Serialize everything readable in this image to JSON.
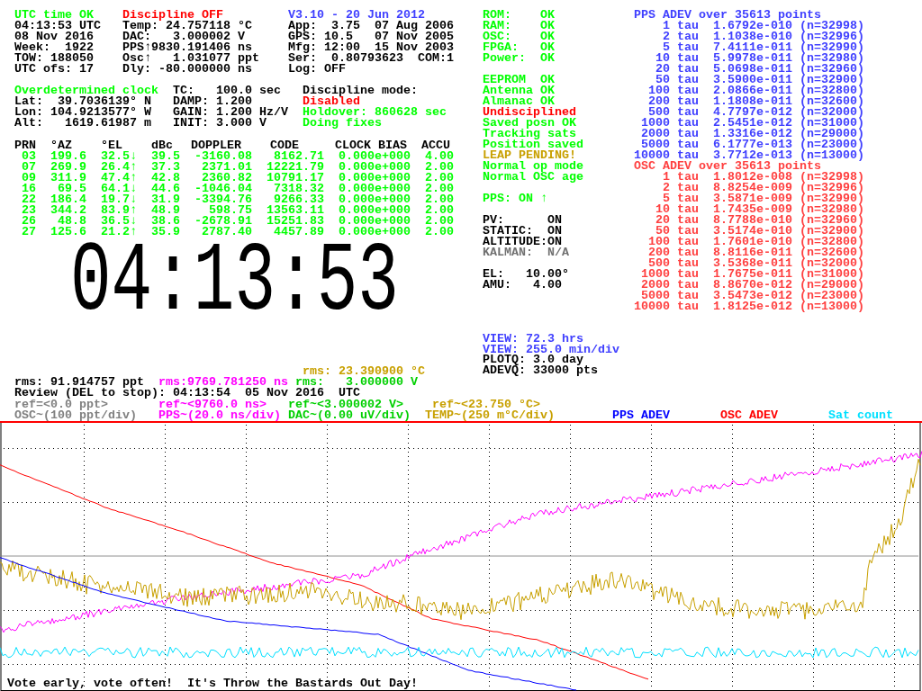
{
  "top_block": [
    {
      "lines": [
        {
          "text": "UTC time OK",
          "color": "#00ff00"
        },
        {
          "text": "04:13:53 UTC",
          "color": "#000000"
        },
        {
          "text": "08 Nov 2016",
          "color": "#000000"
        },
        {
          "text": "Week:  1922",
          "color": "#000000"
        },
        {
          "text": "TOW: 188050",
          "color": "#000000"
        },
        {
          "text": "UTC ofs: 17",
          "color": "#000000"
        }
      ]
    },
    {
      "lines": [
        {
          "text": "Discipline OFF",
          "color": "#ff0000"
        },
        {
          "text": "Temp: 24.757118 °C",
          "color": "#000000"
        },
        {
          "text": "DAC:   3.000002 V",
          "color": "#000000"
        },
        {
          "text": "PPS↑9830.191406 ns",
          "color": "#000000"
        },
        {
          "text": "Osc↑   1.031077 ppt",
          "color": "#000000"
        },
        {
          "text": "Dly: -80.000000 ns",
          "color": "#000000"
        }
      ]
    },
    {
      "lines": [
        {
          "text": "V3.10 - 20 Jun 2012",
          "color": "#4040ff"
        },
        {
          "text": "App:  3.75  07 Aug 2006",
          "color": "#000000"
        },
        {
          "text": "GPS: 10.5   07 Nov 2005",
          "color": "#000000"
        },
        {
          "text": "Mfg: 12:00  15 Nov 2003",
          "color": "#000000"
        },
        {
          "text": "Ser:  0.80793623  COM:1",
          "color": "#000000"
        },
        {
          "text": "Log: OFF",
          "color": "#000000"
        }
      ]
    }
  ],
  "position_block": [
    {
      "lines": [
        {
          "text": "Overdetermined clock",
          "color": "#00ff00"
        },
        {
          "text": "Lat:  39.7036139° N",
          "color": "#000000"
        },
        {
          "text": "Lon: 104.9213577° W",
          "color": "#000000"
        },
        {
          "text": "Alt:   1619.61987 m",
          "color": "#000000"
        }
      ]
    },
    {
      "lines": [
        {
          "text": "TC:   100.0 sec",
          "color": "#000000"
        },
        {
          "text": "DAMP: 1.200",
          "color": "#000000"
        },
        {
          "text": "GAIN: 1.200 Hz/V",
          "color": "#000000"
        },
        {
          "text": "INIT: 3.000 V",
          "color": "#000000"
        }
      ]
    },
    {
      "lines": [
        {
          "text": "Discipline mode:",
          "color": "#000000"
        },
        {
          "text": "Disabled",
          "color": "#ff0000"
        },
        {
          "text": "Holdover: 860628 sec",
          "color": "#00ff00"
        },
        {
          "text": "Doing fixes",
          "color": "#00ff00"
        }
      ]
    }
  ],
  "satellite_table": {
    "columns": [
      "PRN",
      "°AZ",
      "°EL",
      "dBc",
      "DOPPLER",
      "CODE",
      "CLOCK BIAS",
      "ACCU"
    ],
    "rows": [
      [
        "03",
        "199.6",
        "32.5↓",
        "39.5",
        "-3160.08",
        "8162.71",
        "0.000e+000",
        "4.00"
      ],
      [
        "07",
        "269.9",
        "26.4↑",
        "37.3",
        "2371.01",
        "12221.79",
        "0.000e+000",
        "2.00"
      ],
      [
        "09",
        "311.9",
        "47.4↑",
        "42.8",
        "2360.82",
        "10791.17",
        "0.000e+000",
        "2.00"
      ],
      [
        "16",
        "69.5",
        "64.1↓",
        "44.6",
        "-1046.04",
        "7318.32",
        "0.000e+000",
        "2.00"
      ],
      [
        "22",
        "186.4",
        "19.7↓",
        "31.9",
        "-3394.76",
        "9266.33",
        "0.000e+000",
        "2.00"
      ],
      [
        "23",
        "344.2",
        "83.9↑",
        "48.9",
        "598.75",
        "13563.11",
        "0.000e+000",
        "2.00"
      ],
      [
        "26",
        "48.8",
        "36.5↓",
        "38.6",
        "-2678.91",
        "15251.83",
        "0.000e+000",
        "2.00"
      ],
      [
        "27",
        "125.6",
        "21.2↑",
        "35.9",
        "2787.40",
        "4457.89",
        "0.000e+000",
        "2.00"
      ]
    ]
  },
  "clock": "04:13:53",
  "temp_rms": {
    "text": "rms: 23.390900 °C",
    "color": "#c8a000"
  },
  "status_sections": [
    [
      {
        "text": "ROM:    OK",
        "color": "#00ff00"
      },
      {
        "text": "RAM:    OK",
        "color": "#00ff00"
      },
      {
        "text": "OSC:    OK",
        "color": "#00ff00"
      },
      {
        "text": "FPGA:   OK",
        "color": "#00ff00"
      },
      {
        "text": "Power:  OK",
        "color": "#00ff00"
      }
    ],
    [
      {
        "text": "EEPROM  OK",
        "color": "#00ff00"
      },
      {
        "text": "Antenna OK",
        "color": "#00ff00"
      },
      {
        "text": "Almanac OK",
        "color": "#00ff00"
      },
      {
        "text": "Undisciplined",
        "color": "#ff0000"
      },
      {
        "text": "Saved posn OK",
        "color": "#00ff00"
      },
      {
        "text": "Tracking sats",
        "color": "#00ff00"
      },
      {
        "text": "Position saved",
        "color": "#00ff00"
      },
      {
        "text": "LEAP PENDING!",
        "color": "#c8a000"
      },
      {
        "text": "Normal op mode",
        "color": "#00ff00"
      },
      {
        "text": "Normal OSC age",
        "color": "#00ff00"
      }
    ],
    [
      {
        "text": "PPS: ON ↑",
        "color": "#00ff00"
      }
    ],
    [
      {
        "text": "PV:      ON",
        "color": "#000000"
      },
      {
        "text": "STATIC:  ON",
        "color": "#000000"
      },
      {
        "text": "ALTITUDE:ON",
        "color": "#000000"
      },
      {
        "text": "KALMAN:  N/A",
        "color": "#707070"
      }
    ],
    [
      {
        "text": "EL:   10.00°",
        "color": "#000000"
      },
      {
        "text": "AMU:   4.00",
        "color": "#000000"
      }
    ]
  ],
  "adev_tables": [
    {
      "title": "PPS ADEV over 35613 points",
      "color": "#4040ff",
      "rows": [
        "1 tau  1.6792e-010 (n=32998)",
        "2 tau  1.1038e-010 (n=32996)",
        "5 tau  7.4111e-011 (n=32990)",
        "10 tau  5.9978e-011 (n=32980)",
        "20 tau  5.0698e-011 (n=32960)",
        "50 tau  3.5900e-011 (n=32900)",
        "100 tau  2.0866e-011 (n=32800)",
        "200 tau  1.1808e-011 (n=32600)",
        "500 tau  4.7797e-012 (n=32000)",
        "1000 tau  2.5451e-012 (n=31000)",
        "2000 tau  1.3316e-012 (n=29000)",
        "5000 tau  6.1777e-013 (n=23000)",
        "10000 tau  3.7712e-013 (n=13000)"
      ]
    },
    {
      "title": "OSC ADEV over 35613 points",
      "color": "#ff4040",
      "rows": [
        "1 tau  1.8012e-008 (n=32998)",
        "2 tau  8.8254e-009 (n=32996)",
        "5 tau  3.5871e-009 (n=32990)",
        "10 tau  1.7435e-009 (n=32980)",
        "20 tau  8.7788e-010 (n=32960)",
        "50 tau  3.5174e-010 (n=32900)",
        "100 tau  1.7601e-010 (n=32800)",
        "200 tau  8.8116e-011 (n=32600)",
        "500 tau  3.5368e-011 (n=32000)",
        "1000 tau  1.7675e-011 (n=31000)",
        "2000 tau  8.8670e-012 (n=29000)",
        "5000 tau  3.5473e-012 (n=23000)",
        "10000 tau  1.8125e-012 (n=13000)"
      ]
    }
  ],
  "view_settings": [
    {
      "text": "VIEW: 72.3 hrs",
      "color": "#4040ff"
    },
    {
      "text": "VIEW: 255.0 min/div",
      "color": "#4040ff"
    },
    {
      "text": "PLOTQ: 3.0 day",
      "color": "#000000"
    },
    {
      "text": "ADEVQ: 33000 pts",
      "color": "#000000"
    }
  ],
  "rms_row": [
    {
      "text": "rms: 91.914757 ppt",
      "color": "#000000"
    },
    {
      "text": "rms:9769.781250 ns",
      "color": "#ff00ff"
    },
    {
      "text": "rms:   3.000000 V",
      "color": "#00d000"
    }
  ],
  "review": "Review (DEL to stop): 04:13:54  05 Nov 2016  UTC",
  "reference_row": [
    {
      "text": "ref=<0.0 ppt>",
      "color": "#808080"
    },
    {
      "text": "ref~<9760.0 ns>",
      "color": "#ff00ff"
    },
    {
      "text": "ref~<3.000002 V>",
      "color": "#00d000"
    },
    {
      "text": "ref~<23.750 °C>",
      "color": "#c8a000"
    }
  ],
  "legend_row": [
    {
      "text": "OSC~(100 ppt/div)",
      "color": "#808080"
    },
    {
      "text": "PPS~(20.0 ns/div)",
      "color": "#ff00ff"
    },
    {
      "text": "DAC~(0.00 uV/div)",
      "color": "#00d000"
    },
    {
      "text": "TEMP~(250 m°C/div)",
      "color": "#c8a000"
    },
    {
      "text": "PPS ADEV",
      "color": "#0000ff"
    },
    {
      "text": "OSC ADEV",
      "color": "#ff0000"
    },
    {
      "text": "Sat count",
      "color": "#00e0ff"
    }
  ],
  "footer": "Vote early, vote often!  It's Throw the Bastards Out Day!"
}
